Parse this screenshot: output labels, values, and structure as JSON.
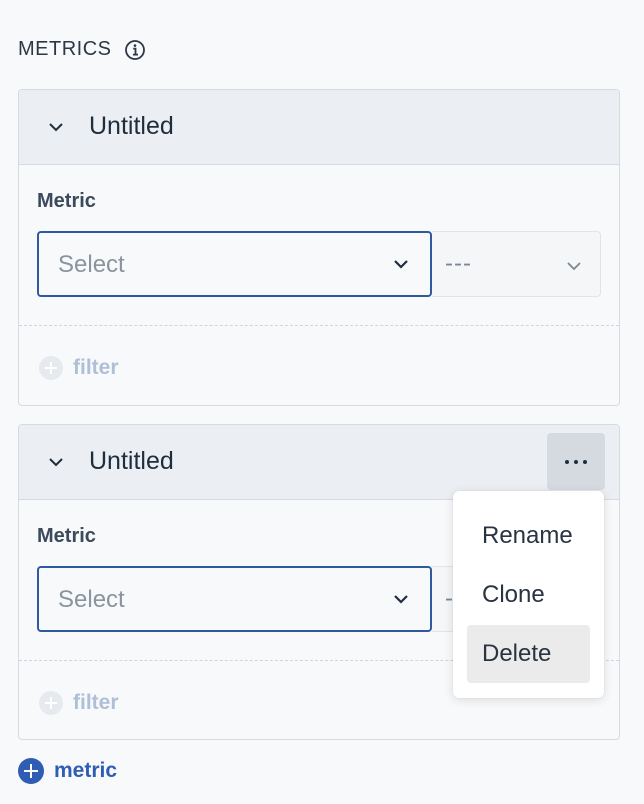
{
  "section": {
    "title": "METRICS",
    "info_icon": "info-circle-icon"
  },
  "cards": [
    {
      "title": "Untitled",
      "metric_label": "Metric",
      "select_placeholder": "Select",
      "aggregation_value": "---",
      "filter_label": "filter"
    },
    {
      "title": "Untitled",
      "metric_label": "Metric",
      "select_placeholder": "Select",
      "aggregation_value": "---",
      "filter_label": "filter"
    }
  ],
  "context_menu": {
    "items": [
      "Rename",
      "Clone",
      "Delete"
    ],
    "highlighted": "Delete"
  },
  "add_metric_label": "metric",
  "colors": {
    "accent": "#2f5db3",
    "select_border": "#2f5aa0",
    "header_bg": "#ebeef2",
    "filter_text": "#aebfd6"
  }
}
